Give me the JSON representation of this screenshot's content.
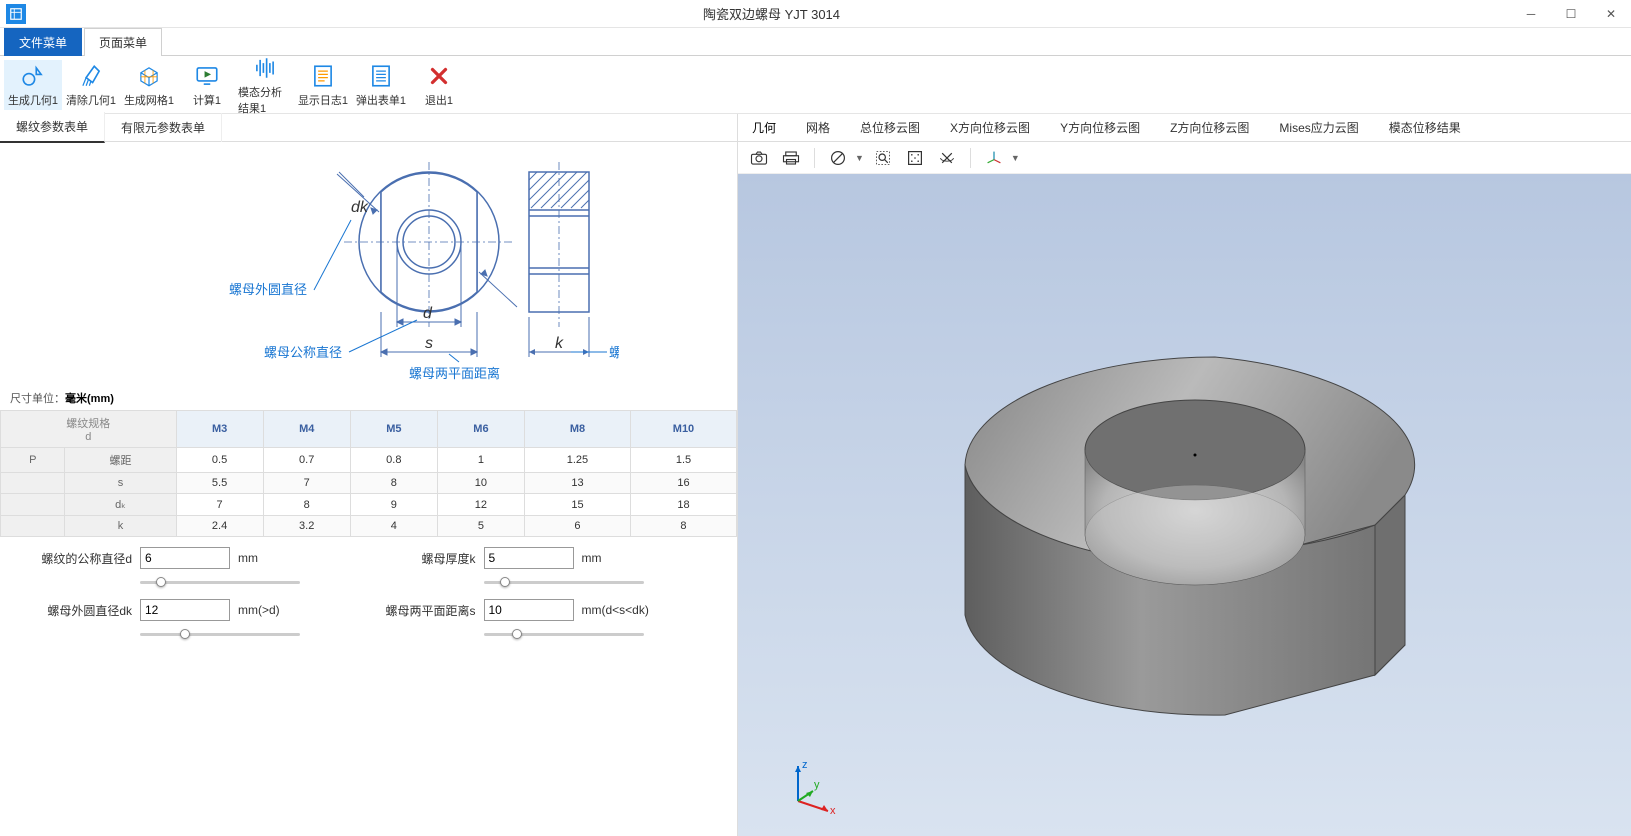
{
  "window": {
    "title": "陶瓷双边螺母 YJT 3014"
  },
  "menu_tabs": {
    "file": "文件菜单",
    "page": "页面菜单"
  },
  "ribbon": [
    {
      "id": "gen-geom-button",
      "label": "生成几何1"
    },
    {
      "id": "clear-geom-button",
      "label": "清除几何1"
    },
    {
      "id": "gen-mesh-button",
      "label": "生成网格1"
    },
    {
      "id": "compute-button",
      "label": "计算1"
    },
    {
      "id": "modal-results-button",
      "label": "模态分析结果1"
    },
    {
      "id": "show-log-button",
      "label": "显示日志1"
    },
    {
      "id": "popup-sheet-button",
      "label": "弹出表单1"
    },
    {
      "id": "exit-button",
      "label": "退出1"
    }
  ],
  "left_tabs": {
    "thread_sheet": "螺纹参数表单",
    "fem_sheet": "有限元参数表单"
  },
  "diagram_labels": {
    "outer_diameter": "螺母外圆直径",
    "nominal_diameter": "螺母公称直径",
    "flat_distance": "螺母两平面距离",
    "thickness": "螺母厚度",
    "dk": "dk",
    "d": "d",
    "s": "s",
    "k": "k"
  },
  "units_note_prefix": "尺寸单位：",
  "units_note_bold": "毫米(mm)",
  "table": {
    "corner_top": "螺纹规格",
    "corner_bottom": "d",
    "columns": [
      "M3",
      "M4",
      "M5",
      "M6",
      "M8",
      "M10"
    ],
    "rows": [
      {
        "h1": "P",
        "h2": "螺距",
        "cells": [
          "0.5",
          "0.7",
          "0.8",
          "1",
          "1.25",
          "1.5"
        ]
      },
      {
        "h1": "",
        "h2": "s",
        "cells": [
          "5.5",
          "7",
          "8",
          "10",
          "13",
          "16"
        ]
      },
      {
        "h1": "",
        "h2": "dₖ",
        "cells": [
          "7",
          "8",
          "9",
          "12",
          "15",
          "18"
        ]
      },
      {
        "h1": "",
        "h2": "k",
        "cells": [
          "2.4",
          "3.2",
          "4",
          "5",
          "6",
          "8"
        ]
      }
    ]
  },
  "params": {
    "d": {
      "label": "螺纹的公称直径d",
      "value": "6",
      "unit": "mm",
      "thumb_pct": 10
    },
    "k": {
      "label": "螺母厚度k",
      "value": "5",
      "unit": "mm",
      "thumb_pct": 10
    },
    "dk": {
      "label": "螺母外圆直径dk",
      "value": "12",
      "unit": "mm(>d)",
      "thumb_pct": 25
    },
    "s": {
      "label": "螺母两平面距离s",
      "value": "10",
      "unit": "mm(d<s<dk)",
      "thumb_pct": 18
    }
  },
  "view_tabs": [
    "几何",
    "网格",
    "总位移云图",
    "X方向位移云图",
    "Y方向位移云图",
    "Z方向位移云图",
    "Mises应力云图",
    "模态位移结果"
  ],
  "axes": {
    "x": "x",
    "y": "y",
    "z": "z"
  }
}
